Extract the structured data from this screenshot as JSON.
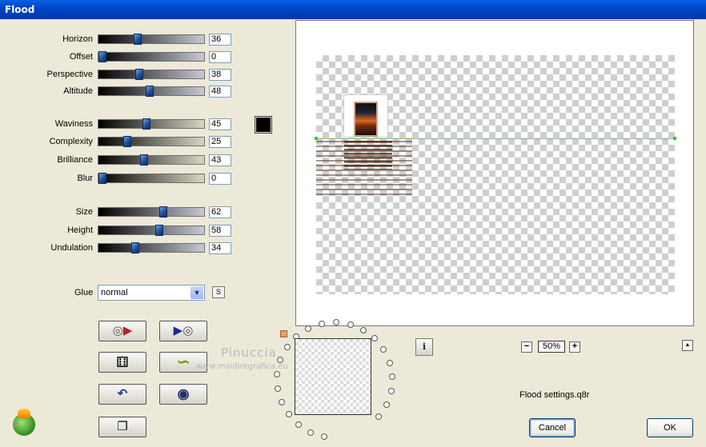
{
  "window": {
    "title": "Flood"
  },
  "sliders": {
    "group1": [
      {
        "label": "Horizon",
        "value": "36",
        "level": 36
      },
      {
        "label": "Offset",
        "value": "0",
        "level": 0
      },
      {
        "label": "Perspective",
        "value": "38",
        "level": 38
      },
      {
        "label": "Altitude",
        "value": "48",
        "level": 48
      }
    ],
    "group2": [
      {
        "label": "Waviness",
        "value": "45",
        "level": 45
      },
      {
        "label": "Complexity",
        "value": "25",
        "level": 25
      },
      {
        "label": "Brilliance",
        "value": "43",
        "level": 43
      },
      {
        "label": "Blur",
        "value": "0",
        "level": 0
      }
    ],
    "group3": [
      {
        "label": "Size",
        "value": "62",
        "level": 62
      },
      {
        "label": "Height",
        "value": "58",
        "level": 58
      },
      {
        "label": "Undulation",
        "value": "34",
        "level": 34
      }
    ]
  },
  "color_swatch": {
    "color": "#000000"
  },
  "glue": {
    "label": "Glue",
    "selected": "normal",
    "s_button": "S"
  },
  "tool_buttons": {
    "reset_icon": "disc-arrow-icon",
    "play_icon": "play-disc-icon",
    "random_icon": "dice-icon",
    "wave_icon": "wave-icon",
    "undo_icon": "undo-arrow-icon",
    "stop_icon": "circle-icon",
    "copy_icon": "copy-icon"
  },
  "watermark": {
    "line1": "Pinuccia",
    "line2": "www.maidiregrafica.eu"
  },
  "zoom": {
    "minus": "−",
    "value": "50%",
    "plus": "+"
  },
  "info_button": "i",
  "preset_file": "Flood settings.q8r",
  "buttons": {
    "cancel": "Cancel",
    "ok": "OK"
  }
}
